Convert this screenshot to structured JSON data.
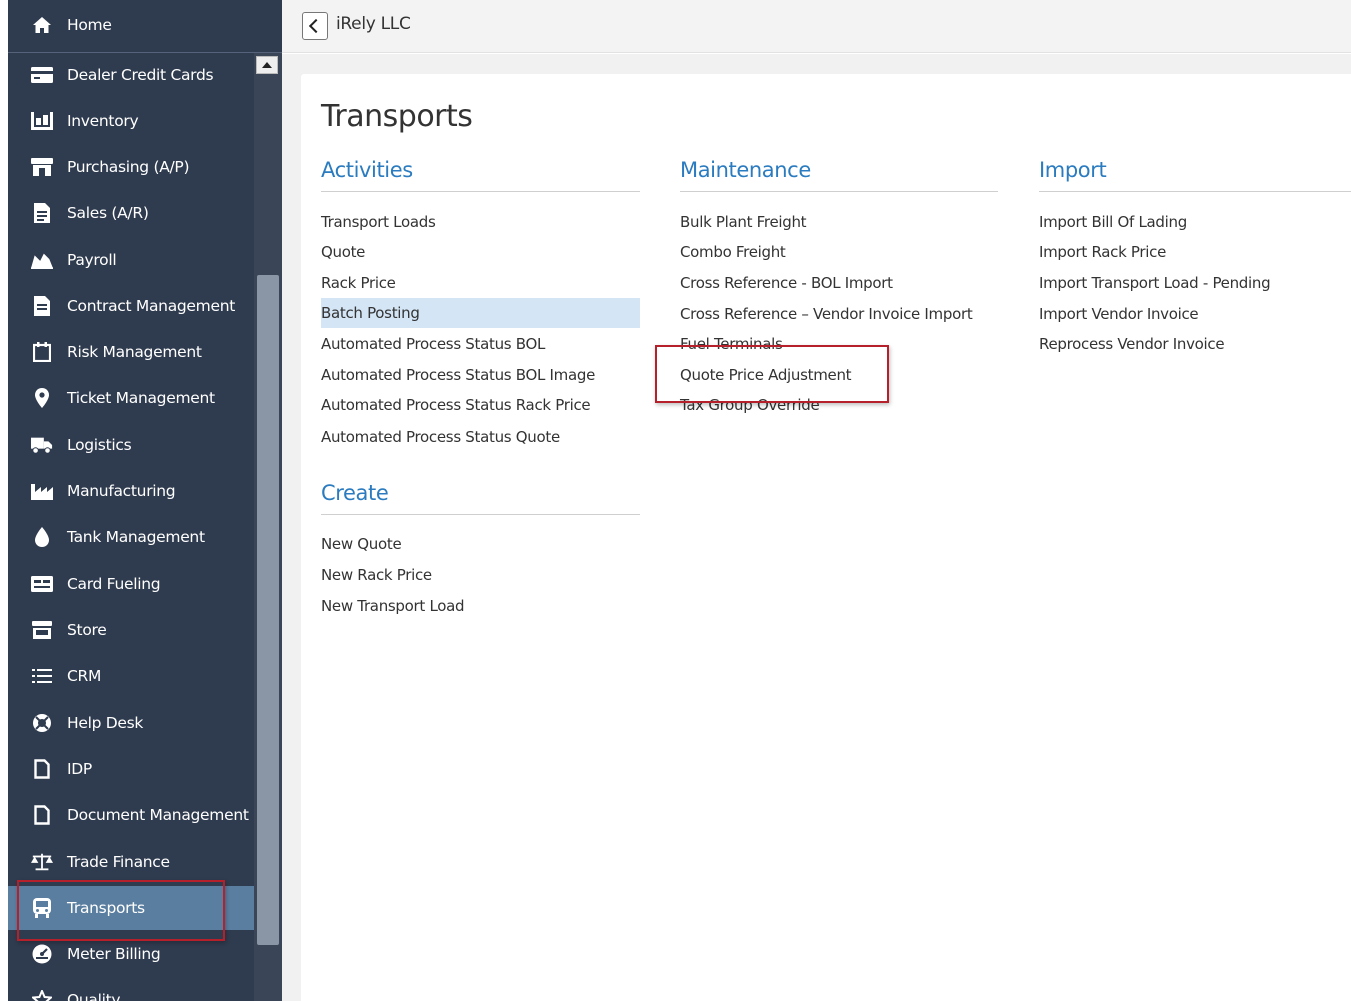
{
  "header": {
    "company": "iRely LLC"
  },
  "sidebar": {
    "home_label": "Home",
    "items": [
      {
        "label": "Dealer Credit Cards",
        "icon": "credit-card-icon"
      },
      {
        "label": "Inventory",
        "icon": "inventory-icon"
      },
      {
        "label": "Purchasing (A/P)",
        "icon": "purchasing-icon"
      },
      {
        "label": "Sales (A/R)",
        "icon": "sales-icon"
      },
      {
        "label": "Payroll",
        "icon": "payroll-icon"
      },
      {
        "label": "Contract Management",
        "icon": "contract-icon"
      },
      {
        "label": "Risk Management",
        "icon": "risk-icon"
      },
      {
        "label": "Ticket Management",
        "icon": "map-pin-icon"
      },
      {
        "label": "Logistics",
        "icon": "truck-icon"
      },
      {
        "label": "Manufacturing",
        "icon": "factory-icon"
      },
      {
        "label": "Tank Management",
        "icon": "drop-icon"
      },
      {
        "label": "Card Fueling",
        "icon": "card-fueling-icon"
      },
      {
        "label": "Store",
        "icon": "store-icon"
      },
      {
        "label": "CRM",
        "icon": "list-icon"
      },
      {
        "label": "Help Desk",
        "icon": "lifebuoy-icon"
      },
      {
        "label": "IDP",
        "icon": "file-icon"
      },
      {
        "label": "Document Management",
        "icon": "document-icon"
      },
      {
        "label": "Trade Finance",
        "icon": "scale-icon"
      },
      {
        "label": "Transports",
        "icon": "bus-icon"
      },
      {
        "label": "Meter Billing",
        "icon": "meter-icon"
      },
      {
        "label": "Quality",
        "icon": "star-icon"
      }
    ],
    "active_item": "Transports"
  },
  "page": {
    "title": "Transports",
    "activities": {
      "title": "Activities",
      "links": [
        "Transport Loads",
        "Quote",
        "Rack Price",
        "Batch Posting",
        "Automated Process Status BOL",
        "Automated Process Status BOL Image",
        "Automated Process Status Rack Price",
        "Automated Process Status Quote"
      ]
    },
    "create": {
      "title": "Create",
      "links": [
        "New Quote",
        "New Rack Price",
        "New Transport Load"
      ]
    },
    "maintenance": {
      "title": "Maintenance",
      "links": [
        "Bulk Plant Freight",
        "Combo Freight",
        "Cross Reference - BOL Import",
        "Cross Reference – Vendor Invoice Import",
        "Fuel Terminals",
        "Quote Price Adjustment",
        "Tax Group Override"
      ]
    },
    "import": {
      "title": "Import",
      "links": [
        "Import Bill Of Lading",
        "Import Rack Price",
        "Import Transport Load - Pending",
        "Import Vendor Invoice",
        "Reprocess Vendor Invoice"
      ]
    }
  },
  "colors": {
    "sidebar_bg": "#2f3b4e",
    "active_item_bg": "#5a7ea0",
    "section_title": "#2a7bbf",
    "highlight_box": "#b5202a",
    "link_highlight": "#d4e5f5"
  }
}
